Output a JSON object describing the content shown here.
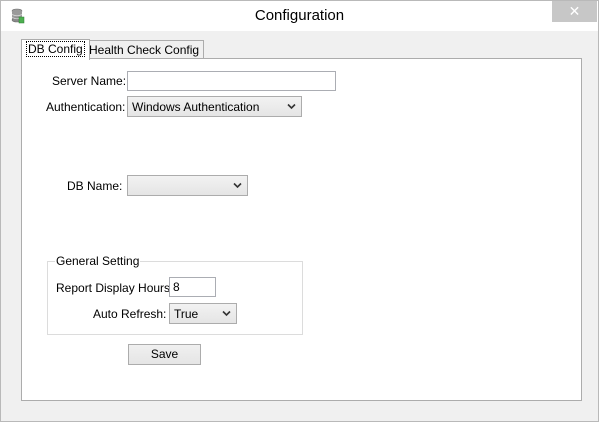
{
  "window": {
    "title": "Configuration",
    "close_glyph": "✕",
    "app_icon": "database-icon"
  },
  "tabs": [
    {
      "label": "DB Config",
      "active": true
    },
    {
      "label": "Health Check Config",
      "active": false
    }
  ],
  "db_config": {
    "server_name_label": "Server Name:",
    "server_name_value": "",
    "authentication_label": "Authentication:",
    "authentication_value": "Windows Authentication",
    "db_name_label": "DB Name:",
    "db_name_value": ""
  },
  "general_setting": {
    "title": "General Setting",
    "report_hours_label": "Report Display Hours:",
    "report_hours_value": "8",
    "auto_refresh_label": "Auto Refresh:",
    "auto_refresh_value": "True"
  },
  "save_label": "Save",
  "colors": {
    "window_bg": "#f0f0f0",
    "panel_bg": "#ffffff",
    "close_button_bg": "#c7c7c7"
  }
}
